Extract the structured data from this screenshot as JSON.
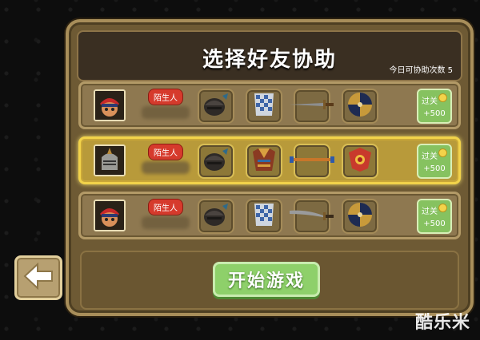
{
  "dialog": {
    "title": "选择好友协助",
    "assist_count_label": "今日可协助次数 5"
  },
  "rows": [
    {
      "badge": "陌生人",
      "avatar": "red-hat-warrior-avatar",
      "items": [
        "hammer-helmet-icon",
        "checkered-armor-icon",
        "sword-icon",
        "round-shield-icon"
      ],
      "reward": {
        "label": "过关",
        "bonus": "+500"
      },
      "selected": false
    },
    {
      "badge": "陌生人",
      "avatar": "knight-helmet-avatar",
      "items": [
        "hammer-helmet-icon",
        "ornate-armor-icon",
        "spear-icon",
        "red-shield-icon"
      ],
      "reward": {
        "label": "过关",
        "bonus": "+500"
      },
      "selected": true
    },
    {
      "badge": "陌生人",
      "avatar": "red-hat-warrior-avatar",
      "items": [
        "hammer-helmet-icon",
        "checkered-armor-icon",
        "scimitar-icon",
        "round-shield-icon"
      ],
      "reward": {
        "label": "过关",
        "bonus": "+500"
      },
      "selected": false
    }
  ],
  "footer": {
    "start_button": "开始游戏"
  },
  "back_button": {
    "icon": "back-arrow-icon"
  },
  "watermark": "酷乐米"
}
